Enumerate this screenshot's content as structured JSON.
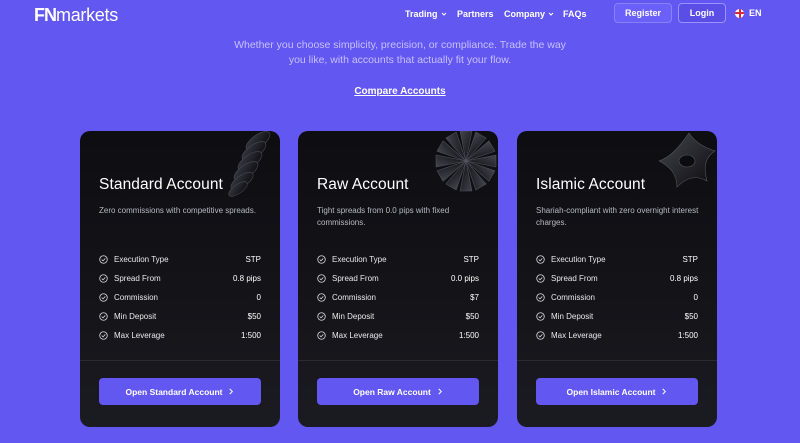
{
  "header": {
    "logo_fn": "FN",
    "logo_rest": "markets",
    "nav": [
      {
        "label": "Trading",
        "has_dropdown": true
      },
      {
        "label": "Partners",
        "has_dropdown": false
      },
      {
        "label": "Company",
        "has_dropdown": true
      },
      {
        "label": "FAQs",
        "has_dropdown": false
      }
    ],
    "register_label": "Register",
    "login_label": "Login",
    "language": "EN",
    "language_icon": "uk-flag-icon"
  },
  "intro": {
    "subtitle_line1": "Whether you choose simplicity, precision, or compliance. Trade the way",
    "subtitle_line2": "you like, with accounts that actually fit your flow.",
    "compare_label": "Compare Accounts"
  },
  "colors": {
    "background": "#6357f2",
    "card": "#0d0d12",
    "button": "#6357f2"
  },
  "cards": [
    {
      "title": "Standard Account",
      "description": "Zero commissions with competitive spreads.",
      "features": [
        {
          "label": "Execution Type",
          "value": "STP"
        },
        {
          "label": "Spread From",
          "value": "0.8 pips"
        },
        {
          "label": "Commission",
          "value": "0"
        },
        {
          "label": "Min Deposit",
          "value": "$50"
        },
        {
          "label": "Max Leverage",
          "value": "1:500"
        }
      ],
      "button_label": "Open Standard Account"
    },
    {
      "title": "Raw Account",
      "description": "Tight spreads from 0.0 pips with fixed commissions.",
      "features": [
        {
          "label": "Execution Type",
          "value": "STP"
        },
        {
          "label": "Spread From",
          "value": "0.0 pips"
        },
        {
          "label": "Commission",
          "value": "$7"
        },
        {
          "label": "Min Deposit",
          "value": "$50"
        },
        {
          "label": "Max Leverage",
          "value": "1:500"
        }
      ],
      "button_label": "Open Raw Account"
    },
    {
      "title": "Islamic Account",
      "description": "Shariah-compliant with zero overnight interest charges.",
      "features": [
        {
          "label": "Execution Type",
          "value": "STP"
        },
        {
          "label": "Spread From",
          "value": "0.8 pips"
        },
        {
          "label": "Commission",
          "value": "0"
        },
        {
          "label": "Min Deposit",
          "value": "$50"
        },
        {
          "label": "Max Leverage",
          "value": "1:500"
        }
      ],
      "button_label": "Open Islamic Account"
    }
  ]
}
